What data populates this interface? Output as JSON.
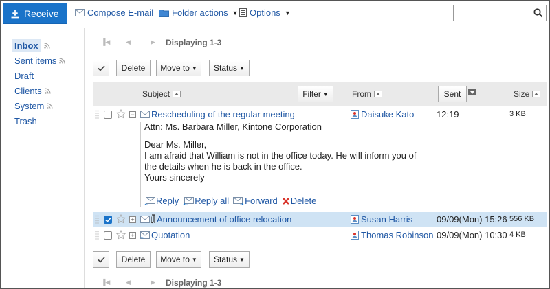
{
  "toolbar": {
    "receive": "Receive",
    "compose": "Compose E-mail",
    "folder_actions": "Folder actions",
    "options": "Options",
    "search_value": ""
  },
  "sidebar": {
    "items": [
      {
        "label": "Inbox",
        "active": true,
        "rss": true
      },
      {
        "label": "Sent items",
        "rss": true
      },
      {
        "label": "Draft",
        "rss": false
      },
      {
        "label": "Clients",
        "rss": true
      },
      {
        "label": "System",
        "rss": true
      },
      {
        "label": "Trash",
        "rss": false
      }
    ]
  },
  "pager": {
    "label": "Displaying 1-3"
  },
  "actions": {
    "delete": "Delete",
    "move_to": "Move to",
    "status": "Status"
  },
  "table": {
    "headers": {
      "subject": "Subject",
      "filter": "Filter",
      "from": "From",
      "sent": "Sent",
      "size": "Size"
    },
    "rows": [
      {
        "subject": "Rescheduling of the regular meeting",
        "from": "Daisuke Kato",
        "date": "12:19",
        "size": "3 KB",
        "checked": false,
        "expanded": true,
        "attachment": false
      },
      {
        "subject": "Announcement of office relocation",
        "from": "Susan Harris",
        "date": "09/09(Mon) 15:26",
        "size": "556 KB",
        "checked": true,
        "expanded": false,
        "attachment": true
      },
      {
        "subject": "Quotation",
        "from": "Thomas Robinson",
        "date": "09/09(Mon) 10:30",
        "size": "4 KB",
        "checked": false,
        "expanded": false,
        "attachment": false
      }
    ]
  },
  "preview": {
    "attn": "Attn: Ms. Barbara Miller, Kintone Corporation",
    "greeting": "Dear Ms. Miller,",
    "body1": "I am afraid that William is not in the office today. He will inform you of",
    "body2": "the details when he is back in the office.",
    "closing": "Yours sincerely",
    "reply": "Reply",
    "reply_all": "Reply all",
    "forward": "Forward",
    "delete": "Delete"
  },
  "colors": {
    "accent": "#1a73c9",
    "link": "#1f57a4",
    "selected_row": "#cfe3f4",
    "delete_red": "#d9342b"
  }
}
